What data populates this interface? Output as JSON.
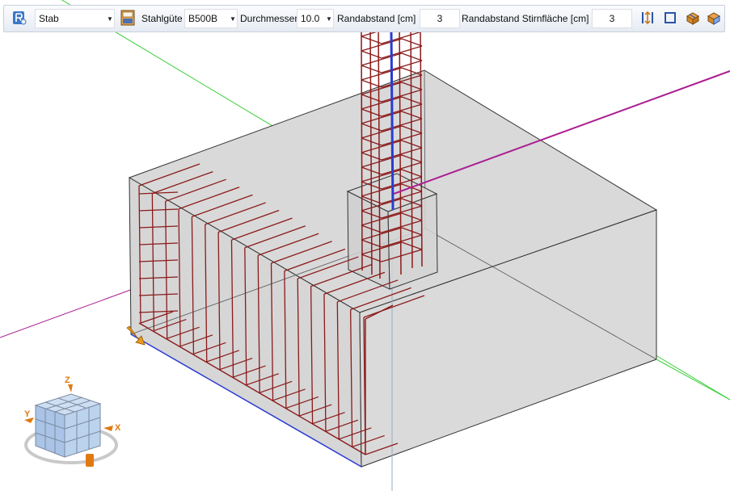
{
  "toolbar": {
    "element_type": {
      "value": "Stab"
    },
    "steel_grade": {
      "label": "Stahlgüte",
      "value": "B500B"
    },
    "diameter": {
      "label": "Durchmesser",
      "value": "10.0"
    },
    "edge_distance": {
      "label": "Randabstand [cm]",
      "value": "3"
    },
    "edge_distance_end": {
      "label": "Randabstand Stirnfläche [cm]",
      "value": "3"
    }
  },
  "view_cube": {
    "axis_z": "Z",
    "axis_x": "X",
    "axis_y": "Y"
  },
  "colors": {
    "rebar": "#8b1a1a",
    "axis_green": "#33cc33",
    "axis_magenta": "#aa1f92",
    "axis_blue": "#2a3cd0",
    "concrete_face": "#d8d8d8",
    "toolbar_bg": "#e9eef5"
  },
  "icons": {
    "rebar_tool": "rebar-shape-icon",
    "properties": "properties-icon",
    "direction": "direction-swap-icon",
    "frame": "frame-icon",
    "distribute": "distribute-icon",
    "place": "place-icon",
    "view_cube": "navigation-cube-icon",
    "origin_arrow": "origin-arrow-icon"
  }
}
